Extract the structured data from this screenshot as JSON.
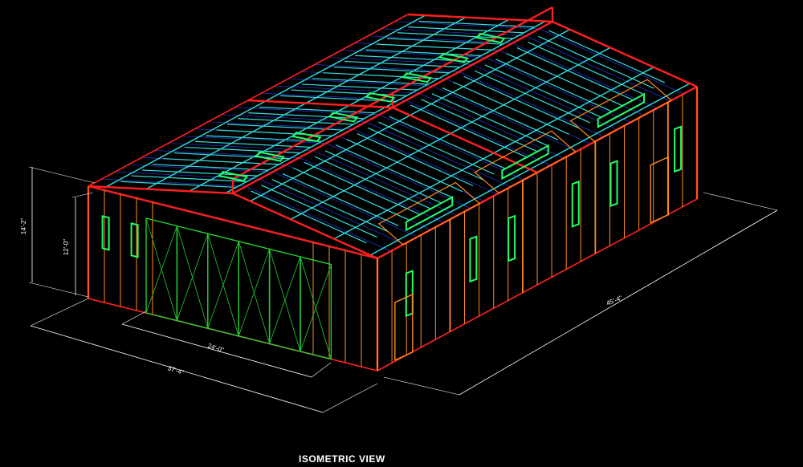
{
  "drawing": {
    "title": "ISOMETRIC VIEW",
    "dimensions": {
      "overall_height": "14'-2\"",
      "wall_height": "12'-0\"",
      "door_width": "24'-0\"",
      "front_width": "37'-4\"",
      "side_length": "45'-4\""
    },
    "colors": {
      "background": "#000000",
      "wall_panels": "#ff8c1a",
      "frame": "#ff1f1f",
      "roof_purlins": "#33e0e0",
      "light_fixtures": "#22ff66",
      "roof_grid": "#2a3cff",
      "doors": "#22cc33",
      "dimension_lines": "#ffffff"
    }
  }
}
